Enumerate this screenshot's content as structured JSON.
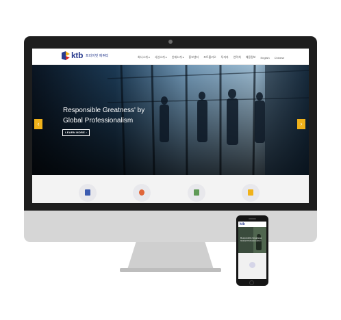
{
  "site": {
    "logo_text": "ktb",
    "logo_sub": "프라이빗 에쿼티",
    "nav": [
      "회사소개 ▾",
      "사업소개 ▾",
      "인재소개 ▾",
      "홍보센터",
      "포트폴리오",
      "투자자",
      "연락처",
      "채용정보",
      "English",
      "Chinese"
    ]
  },
  "hero": {
    "title_line1": "Responsible Greatness' by",
    "title_line2": "Global Professionalism",
    "button_label": "LEARN MORE ›",
    "prev_arrow": "‹",
    "next_arrow": "›"
  },
  "features": {
    "icons": [
      "document-icon",
      "person-icon",
      "briefcase-icon",
      "chart-icon"
    ]
  },
  "phone": {
    "logo_text": "ktb",
    "hero_line1": "Responsible Greatness",
    "hero_line2": "Global Professionalism"
  },
  "colors": {
    "brand_blue": "#2a3c8f",
    "accent_orange": "#f0b21a",
    "bezel": "#1e1e1e"
  }
}
